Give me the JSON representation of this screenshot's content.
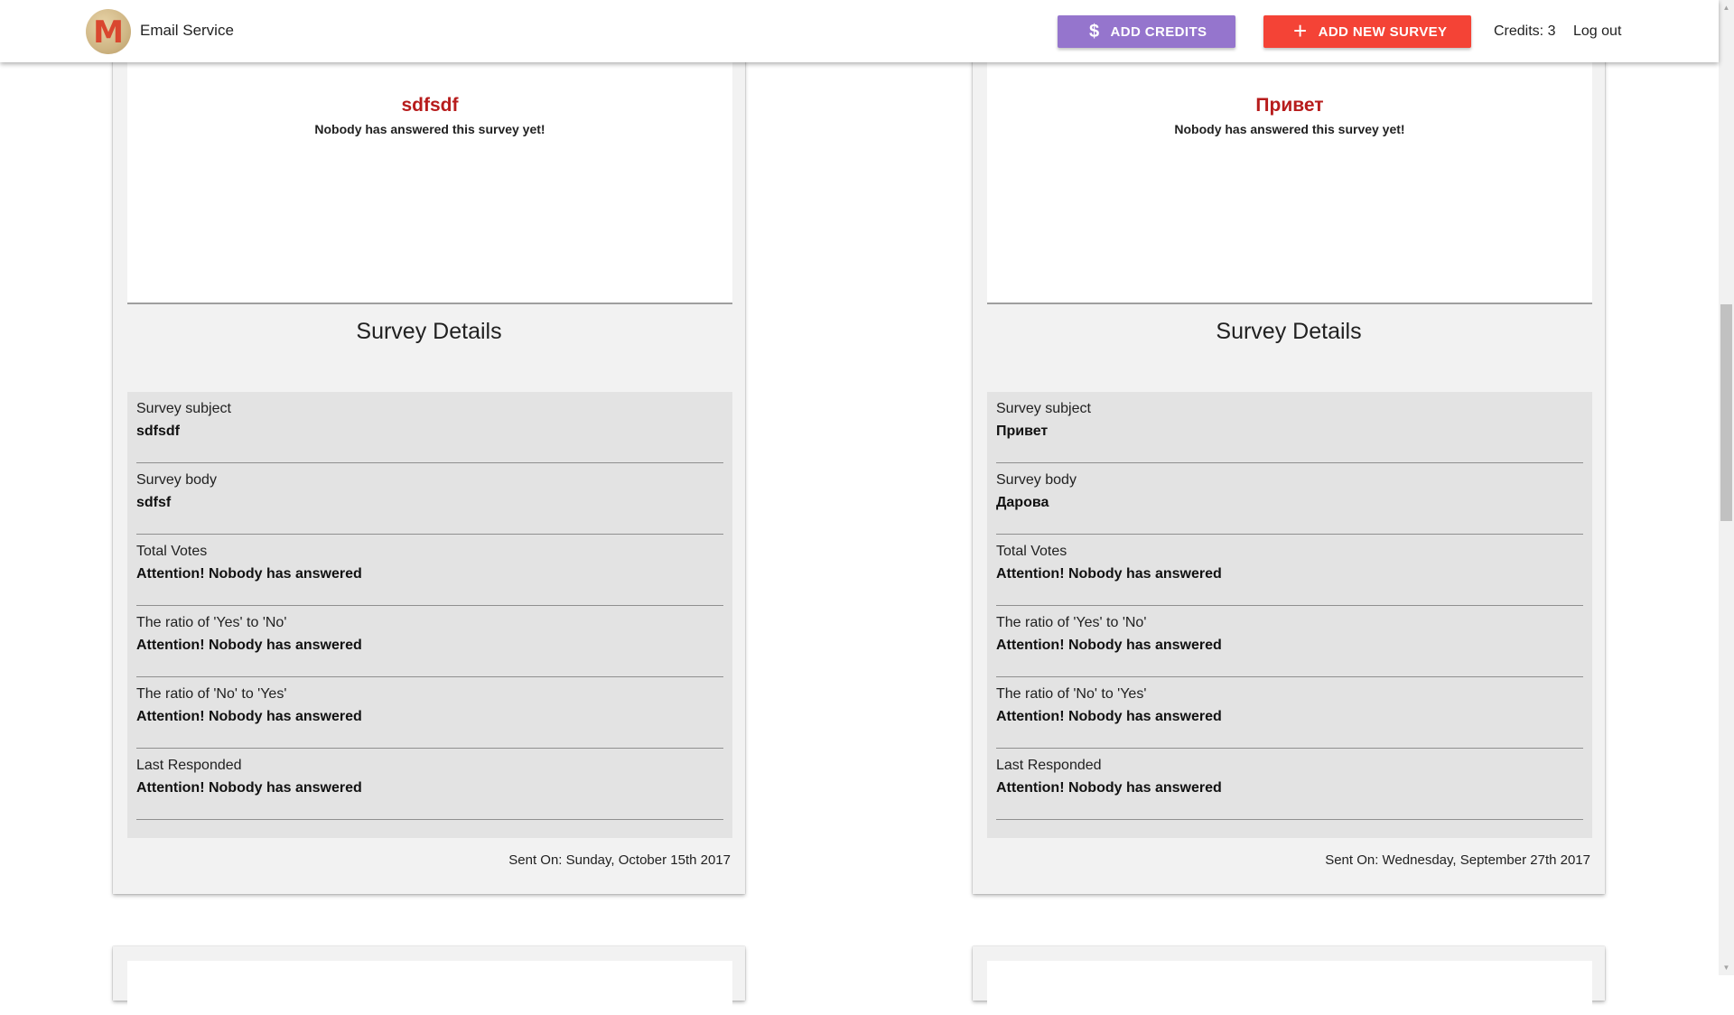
{
  "header": {
    "logo_letter": "M",
    "brand": "Email Service",
    "add_credits_label": "ADD CREDITS",
    "add_credits_icon": "$",
    "add_survey_label": "ADD NEW SURVEY",
    "add_survey_icon": "+",
    "credits_text": "Credits: 3",
    "logout_label": "Log out",
    "colors": {
      "add_credits": "#9575cd",
      "add_survey": "#f44336",
      "survey_title": "#b71c1c"
    }
  },
  "surveys": [
    {
      "title": "sdfsdf",
      "no_answers_message": "Nobody has answered this survey yet!",
      "details_heading": "Survey Details",
      "details": [
        {
          "label": "Survey subject",
          "value": "sdfsdf"
        },
        {
          "label": "Survey body",
          "value": "sdfsf"
        },
        {
          "label": "Total Votes",
          "value": "Attention! Nobody has answered"
        },
        {
          "label": "The ratio of 'Yes' to 'No'",
          "value": "Attention! Nobody has answered"
        },
        {
          "label": "The ratio of 'No' to 'Yes'",
          "value": "Attention! Nobody has answered"
        },
        {
          "label": "Last Responded",
          "value": "Attention! Nobody has answered"
        }
      ],
      "sent_on": "Sent On: Sunday, October 15th 2017"
    },
    {
      "title": "Привет",
      "no_answers_message": "Nobody has answered this survey yet!",
      "details_heading": "Survey Details",
      "details": [
        {
          "label": "Survey subject",
          "value": "Привет"
        },
        {
          "label": "Survey body",
          "value": "Дарова"
        },
        {
          "label": "Total Votes",
          "value": "Attention! Nobody has answered"
        },
        {
          "label": "The ratio of 'Yes' to 'No'",
          "value": "Attention! Nobody has answered"
        },
        {
          "label": "The ratio of 'No' to 'Yes'",
          "value": "Attention! Nobody has answered"
        },
        {
          "label": "Last Responded",
          "value": "Attention! Nobody has answered"
        }
      ],
      "sent_on": "Sent On: Wednesday, September 27th 2017"
    }
  ]
}
